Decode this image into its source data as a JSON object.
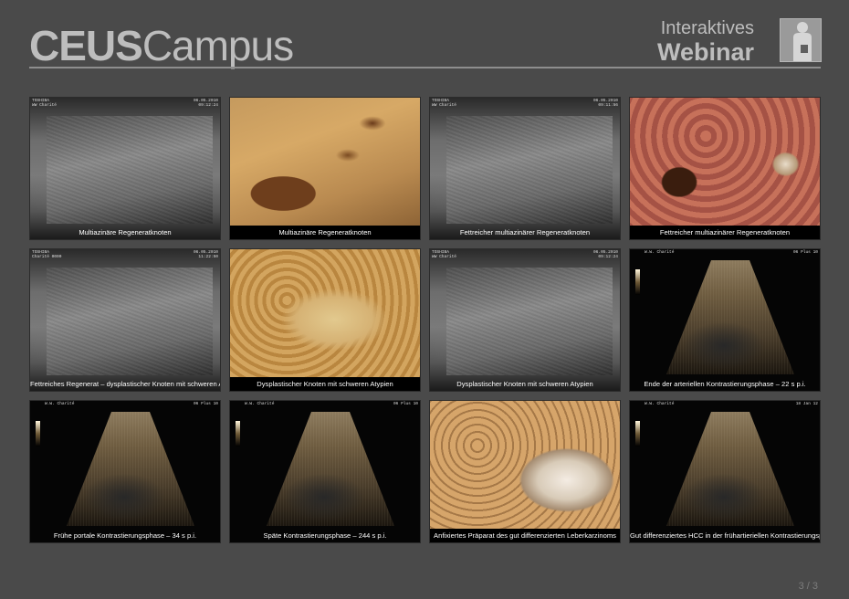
{
  "header": {
    "logo_bold": "CEUS",
    "logo_light": "Campus",
    "webinar_line1": "Interaktives",
    "webinar_line2": "Webinar"
  },
  "tiles": [
    {
      "caption": "Multiazinäre Regeneratknoten",
      "kind": "us-gray",
      "meta_left": "TOSHIBA\nWW Charité",
      "meta_right": "06.05.2010\n09:12:24"
    },
    {
      "caption": "Multiazinäre Regeneratknoten",
      "kind": "tissue-a"
    },
    {
      "caption": "Fettreicher multiazinärer Regeneratknoten",
      "kind": "us-gray",
      "meta_left": "TOSHIBA\nWW Charité",
      "meta_right": "06.05.2010\n09:11:56"
    },
    {
      "caption": "Fettreicher multiazinärer Regeneratknoten",
      "kind": "tissue-b"
    },
    {
      "caption": "Fettreiches Regenerat – dysplastischer Knoten mit schweren Atypien",
      "kind": "us-gray",
      "meta_left": "TOSHIBA\nCharité 0000",
      "meta_right": "06.05.2010\n11:22:50"
    },
    {
      "caption": "Dysplastischer Knoten mit schweren Atypien",
      "kind": "tissue-c"
    },
    {
      "caption": "Dysplastischer Knoten mit schweren Atypien",
      "kind": "us-gray",
      "meta_left": "TOSHIBA\nWW Charité",
      "meta_right": "06.05.2010\n09:12:24"
    },
    {
      "caption": "Ende der arteriellen Kontrastierungsphase – 22 s p.i.",
      "kind": "ceus",
      "meta_left": "W.W. Charité",
      "meta_right": "06 Plus 10"
    },
    {
      "caption": "Frühe portale Kontrastierungsphase – 34 s p.i.",
      "kind": "ceus",
      "meta_left": "W.W. Charité",
      "meta_right": "06 Plus 10"
    },
    {
      "caption": "Späte Kontrastierungsphase – 244 s p.i.",
      "kind": "ceus",
      "meta_left": "W.W. Charité",
      "meta_right": "06 Plus 10"
    },
    {
      "caption": "Anfixiertes Präparat des gut differenzierten Leberkarzinoms",
      "kind": "tissue-d"
    },
    {
      "caption": "Gut differenziertes HCC in der frühartieriellen Kontrastierungsphase",
      "kind": "ceus",
      "meta_left": "W.W. Charité",
      "meta_right": "18 Jan 12"
    }
  ],
  "page_indicator": "3 / 3",
  "icons": {
    "human": "human-body-icon"
  }
}
